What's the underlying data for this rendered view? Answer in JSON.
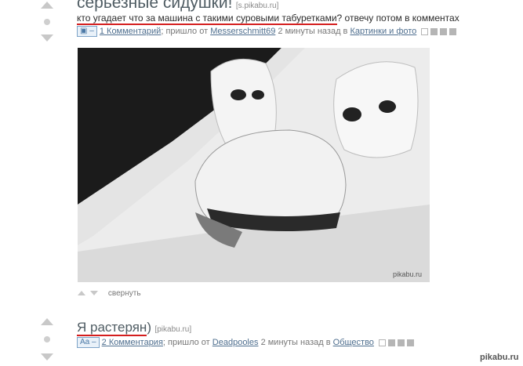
{
  "post1": {
    "title": "серьезные сидушки!",
    "source": "[s.pikabu.ru]",
    "desc_highlight": "кто угадает что за машина с такими суровыми табуретками",
    "desc_rest": "? отвечу потом в комментах",
    "tag": "▣ –",
    "comments": "1 Комментарий",
    "from_text": "; пришло от",
    "author": "Messerschmitt69",
    "time": "2 минуты назад в",
    "category": "Картинки и фото",
    "image_watermark": "pikabu.ru",
    "collapse": "свернуть"
  },
  "post2": {
    "title": "Я растерян",
    "title_suffix": ")",
    "source": "[pikabu.ru]",
    "tag": "Aa –",
    "comments": "2 Комментария",
    "from_text": "; пришло от",
    "author": "Deadpooles",
    "time": "2 минуты назад в",
    "category": "Общество"
  },
  "watermark": "pikabu.ru",
  "colors": {
    "highlight_underline": "#d41e1e",
    "link": "#4f6f8f",
    "tag": "#7ca3c8"
  }
}
